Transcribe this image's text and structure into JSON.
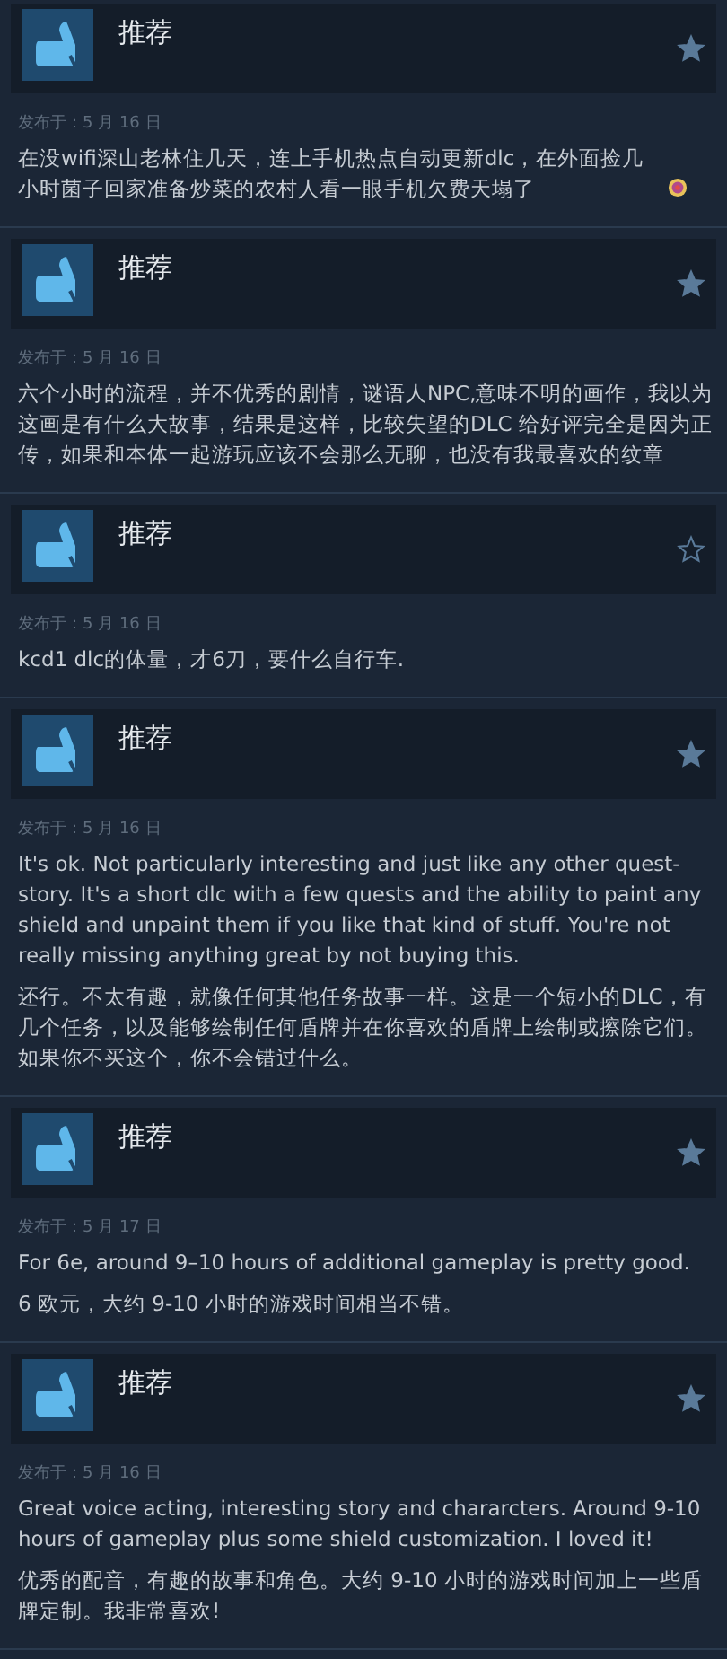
{
  "reviews": [
    {
      "verdict": "推荐",
      "starred": true,
      "date": "发布于：5 月 16 日",
      "paragraphs": [
        "在没wifi深山老林住几天，连上手机热点自动更新dlc，在外面捡几小时菌子回家准备炒菜的农村人看一眼手机欠费天塌了"
      ],
      "emoji": true
    },
    {
      "verdict": "推荐",
      "starred": true,
      "date": "发布于：5 月 16 日",
      "paragraphs": [
        "六个小时的流程，并不优秀的剧情，谜语人NPC,意味不明的画作，我以为这画是有什么大故事，结果是这样，比较失望的DLC 给好评完全是因为正传，如果和本体一起游玩应该不会那么无聊，也没有我最喜欢的纹章"
      ],
      "emoji": false
    },
    {
      "verdict": "推荐",
      "starred": false,
      "date": "发布于：5 月 16 日",
      "paragraphs": [
        "kcd1 dlc的体量，才6刀，要什么自行车."
      ],
      "emoji": false
    },
    {
      "verdict": "推荐",
      "starred": true,
      "date": "发布于：5 月 16 日",
      "paragraphs": [
        "It's ok. Not particularly interesting and just like any other quest-story. It's a short dlc with a few quests and the ability to paint any shield and unpaint them if you like that kind of stuff. You're not really missing anything great by not buying this.",
        "还行。不太有趣，就像任何其他任务故事一样。这是一个短小的DLC，有几个任务，以及能够绘制任何盾牌并在你喜欢的盾牌上绘制或擦除它们。如果你不买这个，你不会错过什么。"
      ],
      "emoji": false
    },
    {
      "verdict": "推荐",
      "starred": true,
      "date": "发布于：5 月 17 日",
      "paragraphs": [
        "For 6e, around 9–10 hours of additional gameplay is pretty good.",
        "6 欧元，大约 9-10 小时的游戏时间相当不错。"
      ],
      "emoji": false
    },
    {
      "verdict": "推荐",
      "starred": true,
      "date": "发布于：5 月 16 日",
      "paragraphs": [
        "Great voice acting, interesting story and chararcters. Around 9-10 hours of gameplay plus some shield customization. I loved it!",
        "优秀的配音，有趣的故事和角色。大约 9-10 小时的游戏时间加上一些盾牌定制。我非常喜欢!"
      ],
      "emoji": false
    }
  ]
}
